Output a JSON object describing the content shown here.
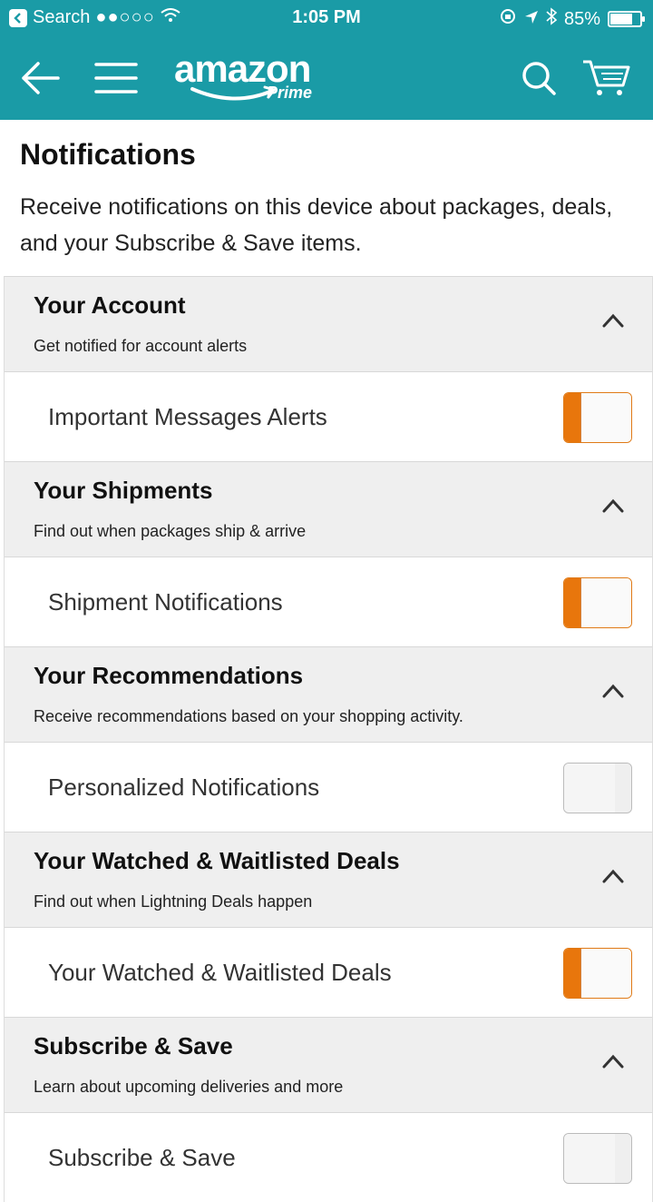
{
  "status_bar": {
    "back_label": "Search",
    "time": "1:05 PM",
    "battery": "85%",
    "battery_level": 0.85
  },
  "nav": {
    "logo_text": "amazon",
    "logo_sub": "Prime"
  },
  "page": {
    "title": "Notifications",
    "description": "Receive notifications on this device about packages, deals, and your Subscribe & Save items."
  },
  "sections": [
    {
      "title": "Your Account",
      "subtitle": "Get notified for account alerts",
      "row_label": "Important Messages Alerts",
      "enabled": true
    },
    {
      "title": "Your Shipments",
      "subtitle": "Find out when packages ship & arrive",
      "row_label": "Shipment Notifications",
      "enabled": true
    },
    {
      "title": "Your Recommendations",
      "subtitle": "Receive recommendations based on your shopping activity.",
      "row_label": "Personalized Notifications",
      "enabled": false
    },
    {
      "title": "Your Watched & Waitlisted Deals",
      "subtitle": "Find out when Lightning Deals happen",
      "row_label": "Your Watched & Waitlisted Deals",
      "enabled": true
    },
    {
      "title": "Subscribe & Save",
      "subtitle": "Learn about upcoming deliveries and more",
      "row_label": "Subscribe & Save",
      "enabled": false
    }
  ],
  "colors": {
    "brand_teal": "#1a9ba6",
    "toggle_on": "#e8760c",
    "section_bg": "#efefef"
  }
}
